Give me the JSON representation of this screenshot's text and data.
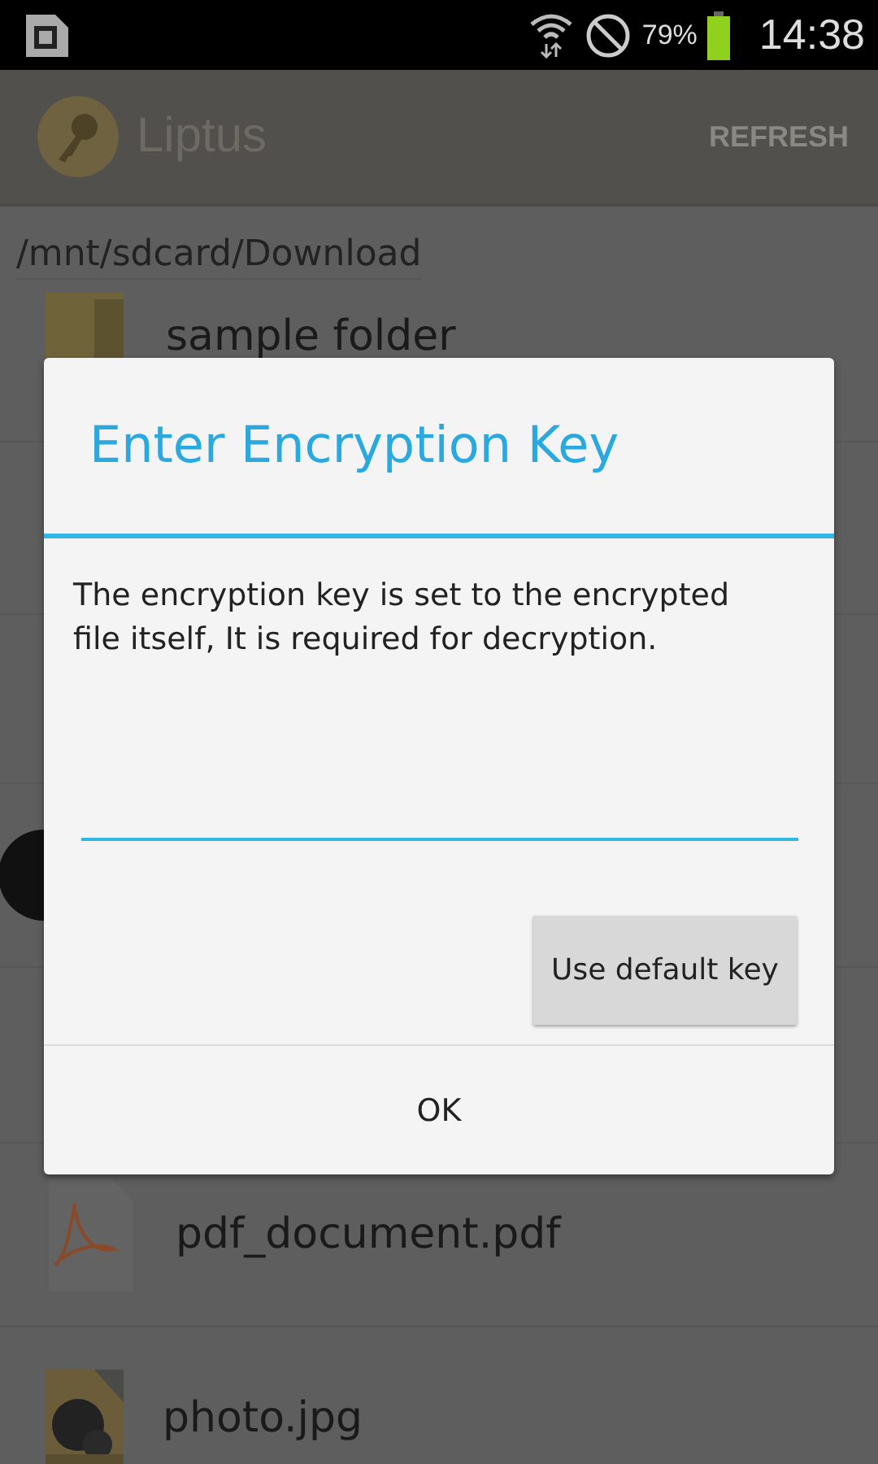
{
  "status_bar": {
    "battery": "79%",
    "time": "14:38"
  },
  "action_bar": {
    "title": "Liptus",
    "actions": [
      "REFRESH"
    ]
  },
  "path": "/mnt/sdcard/Download",
  "files": [
    {
      "name": "sample folder",
      "kind": "folder"
    },
    {
      "name": "pdf_document.pdf",
      "kind": "pdf"
    },
    {
      "name": "photo.jpg"
    }
  ],
  "dialog": {
    "title": "Enter Encryption Key",
    "message": "The encryption key is set to the encrypted file itself, It is required for decryption.",
    "buttons": [
      "Use default key"
    ],
    "footer_buttons": [
      "OK"
    ]
  }
}
